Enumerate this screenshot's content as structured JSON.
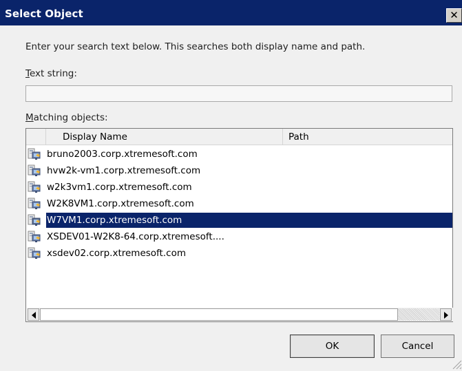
{
  "window": {
    "title": "Select Object",
    "close_glyph": "✕"
  },
  "instruction": "Enter your search text below. This searches both display name and path.",
  "text_string": {
    "label": "Text string:",
    "value": "",
    "placeholder": ""
  },
  "matching": {
    "label": "Matching objects:",
    "columns": [
      "Display Name",
      "Path"
    ],
    "rows": [
      {
        "name": "bruno2003.corp.xtremesoft.com",
        "path": "",
        "icon": "computer-icon",
        "selected": false
      },
      {
        "name": "hvw2k-vm1.corp.xtremesoft.com",
        "path": "",
        "icon": "computer-icon",
        "selected": false
      },
      {
        "name": "w2k3vm1.corp.xtremesoft.com",
        "path": "",
        "icon": "computer-icon",
        "selected": false
      },
      {
        "name": "W2K8VM1.corp.xtremesoft.com",
        "path": "",
        "icon": "computer-icon",
        "selected": false
      },
      {
        "name": "W7VM1.corp.xtremesoft.com",
        "path": "",
        "icon": "computer-icon",
        "selected": true
      },
      {
        "name": "XSDEV01-W2K8-64.corp.xtremesoft....",
        "path": "",
        "icon": "computer-icon",
        "selected": false
      },
      {
        "name": "xsdev02.corp.xtremesoft.com",
        "path": "",
        "icon": "computer-icon",
        "selected": false
      }
    ]
  },
  "buttons": {
    "ok": "OK",
    "cancel": "Cancel"
  },
  "colors": {
    "titlebar": "#0a246a",
    "selection": "#0a246a",
    "background": "#f0f0f0"
  }
}
